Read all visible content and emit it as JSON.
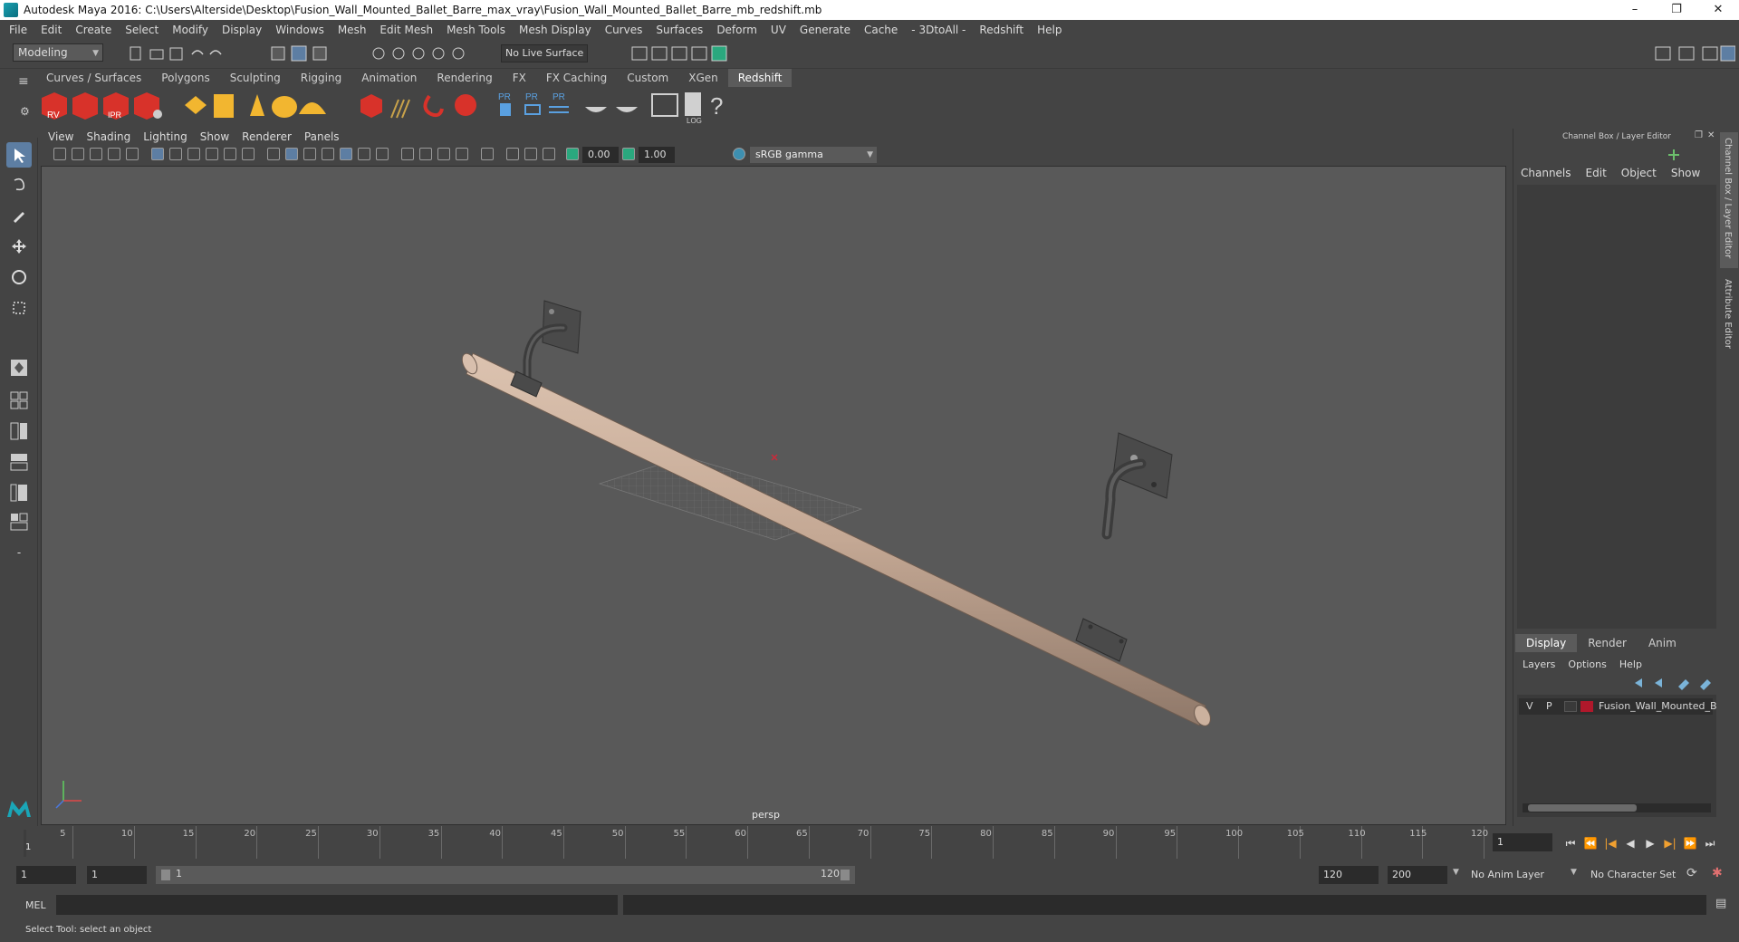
{
  "window": {
    "title": "Autodesk Maya 2016: C:\\Users\\Alterside\\Desktop\\Fusion_Wall_Mounted_Ballet_Barre_max_vray\\Fusion_Wall_Mounted_Ballet_Barre_mb_redshift.mb",
    "controls": [
      "–",
      "❐",
      "✕"
    ]
  },
  "menubar": [
    "File",
    "Edit",
    "Create",
    "Select",
    "Modify",
    "Display",
    "Windows",
    "Mesh",
    "Edit Mesh",
    "Mesh Tools",
    "Mesh Display",
    "Curves",
    "Surfaces",
    "Deform",
    "UV",
    "Generate",
    "Cache",
    "- 3DtoAll -",
    "Redshift",
    "Help"
  ],
  "statusline": {
    "mode": "Modeling",
    "live_surface": "No Live Surface"
  },
  "shelf": {
    "tabs": [
      "Curves / Surfaces",
      "Polygons",
      "Sculpting",
      "Rigging",
      "Animation",
      "Rendering",
      "FX",
      "FX Caching",
      "Custom",
      "XGen",
      "Redshift"
    ],
    "active_tab": "Redshift",
    "icon_labels": {
      "rv": "RV",
      "ipr": "IPR",
      "pr1": "PR",
      "pr2": "PR",
      "pr3": "PR",
      "log": "LOG",
      "help": "?"
    }
  },
  "viewport": {
    "menu": [
      "View",
      "Shading",
      "Lighting",
      "Show",
      "Renderer",
      "Panels"
    ],
    "exposure": "0.00",
    "gamma_value": "1.00",
    "color_space": "sRGB gamma",
    "camera_label": "persp"
  },
  "channel_box": {
    "title": "Channel Box / Layer Editor",
    "menu": [
      "Channels",
      "Edit",
      "Object",
      "Show"
    ],
    "layer_tabs": [
      "Display",
      "Render",
      "Anim"
    ],
    "active_layer_tab": "Display",
    "layer_menu": [
      "Layers",
      "Options",
      "Help"
    ],
    "layer": {
      "v": "V",
      "p": "P",
      "name": "Fusion_Wall_Mounted_B",
      "color": "#b0182b"
    },
    "side_tabs": [
      "Channel Box / Layer Editor",
      "Attribute Editor"
    ]
  },
  "timeline": {
    "ticks": [
      "5",
      "10",
      "15",
      "20",
      "25",
      "30",
      "35",
      "40",
      "45",
      "50",
      "55",
      "60",
      "65",
      "70",
      "75",
      "80",
      "85",
      "90",
      "95",
      "100",
      "105",
      "110",
      "115",
      "120"
    ],
    "start_marker": "1",
    "current_frame": "1",
    "playback_buttons": [
      "⏮",
      "⏪",
      "|◀",
      "◀",
      "▶",
      "▶|",
      "⏩",
      "⏭"
    ]
  },
  "range": {
    "start": "1",
    "playback_start": "1",
    "slider_start": "1",
    "slider_end": "120",
    "playback_end": "120",
    "end": "200",
    "anim_layer": "No Anim Layer",
    "character_set": "No Character Set"
  },
  "command_line": {
    "label": "MEL"
  },
  "help_line": "Select Tool: select an object",
  "colors": {
    "accent": "#5d7ea3",
    "redshift_red": "#d8322a",
    "shelf_yellow": "#f2b630",
    "barre": "#c6aa95",
    "bracket": "#4a4a4a"
  }
}
